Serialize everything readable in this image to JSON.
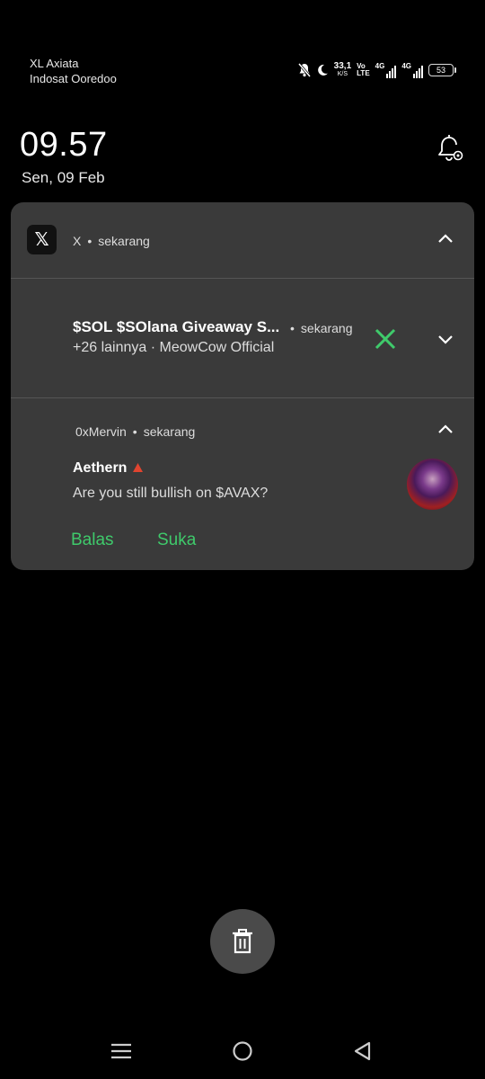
{
  "status_bar": {
    "carrier_1": "XL Axiata",
    "carrier_2": "Indosat Ooredoo",
    "net_speed_value": "33,1",
    "net_speed_unit": "K/S",
    "volte_top": "Vo",
    "volte_bottom": "LTE",
    "sim1_type": "4G",
    "sim2_type": "4G",
    "battery_level": "53",
    "icons": [
      "mute-icon",
      "moon-icon"
    ]
  },
  "clock": {
    "time": "09.57",
    "date": "Sen, 09 Feb"
  },
  "notification_group": {
    "app_name": "X",
    "time": "sekarang",
    "app_icon_glyph": "𝕏",
    "notifications": [
      {
        "title": "$SOL $SOlana Giveaway S...",
        "time": "sekarang",
        "subtitle": "+26 lainnya · MeowCow Official"
      },
      {
        "account": "0xMervin",
        "time": "sekarang",
        "sender": "Aethern",
        "message": "Are you still bullish on $AVAX?",
        "actions": [
          "Balas",
          "Suka"
        ]
      }
    ]
  },
  "colors": {
    "accent_green": "#3fca6b",
    "card_bg": "#3a3a3a",
    "background": "#000000"
  }
}
